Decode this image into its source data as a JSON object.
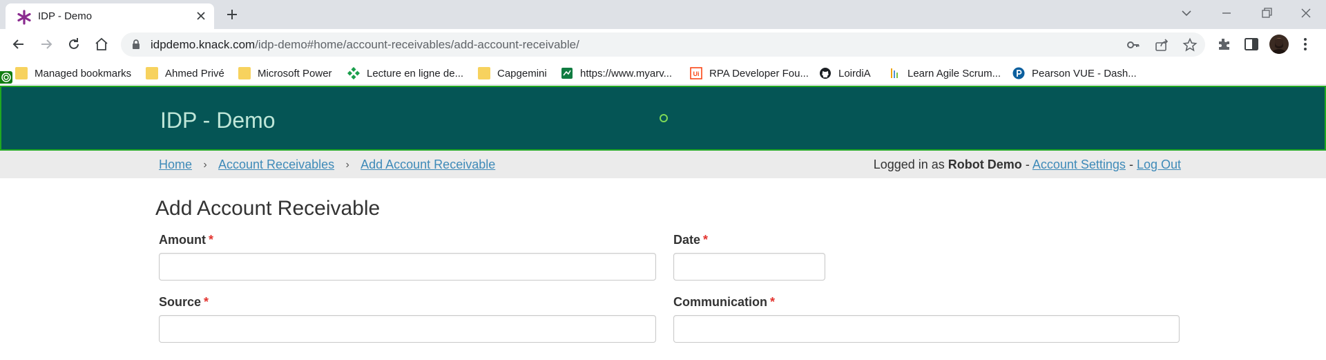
{
  "browser": {
    "tab_title": "IDP - Demo",
    "url_host": "idpdemo.knack.com",
    "url_path": "/idp-demo#home/account-receivables/add-account-receivable/",
    "bookmarks": [
      {
        "label": "Managed bookmarks",
        "icon": "folder-icon"
      },
      {
        "label": "Ahmed Privé",
        "icon": "folder-icon"
      },
      {
        "label": "Microsoft Power",
        "icon": "folder-icon"
      },
      {
        "label": "Lecture en ligne de...",
        "icon": "green-diamond-icon"
      },
      {
        "label": "Capgemini",
        "icon": "folder-icon"
      },
      {
        "label": "https://www.myarv...",
        "icon": "green-square-icon"
      },
      {
        "label": "RPA Developer Fou...",
        "icon": "uipath-icon"
      },
      {
        "label": "LoirdiA",
        "icon": "github-icon"
      },
      {
        "label": "Learn Agile Scrum...",
        "icon": "bars-icon"
      },
      {
        "label": "Pearson VUE - Dash...",
        "icon": "pearson-icon"
      }
    ]
  },
  "app": {
    "title": "IDP - Demo",
    "breadcrumb": [
      "Home",
      "Account Receivables",
      "Add Account Receivable"
    ],
    "session": {
      "prefix": "Logged in as",
      "user": "Robot Demo",
      "separator": "-",
      "account_settings": "Account Settings",
      "logout": "Log Out"
    }
  },
  "form": {
    "title": "Add Account Receivable",
    "required_mark": "*",
    "fields": {
      "amount": {
        "label": "Amount",
        "value": ""
      },
      "date": {
        "label": "Date",
        "value": ""
      },
      "source": {
        "label": "Source",
        "value": ""
      },
      "communication": {
        "label": "Communication",
        "value": ""
      }
    }
  },
  "colors": {
    "header_bg": "#055555",
    "header_title": "#bfe6d8",
    "link": "#3e8ab8",
    "required": "#e3342f"
  }
}
